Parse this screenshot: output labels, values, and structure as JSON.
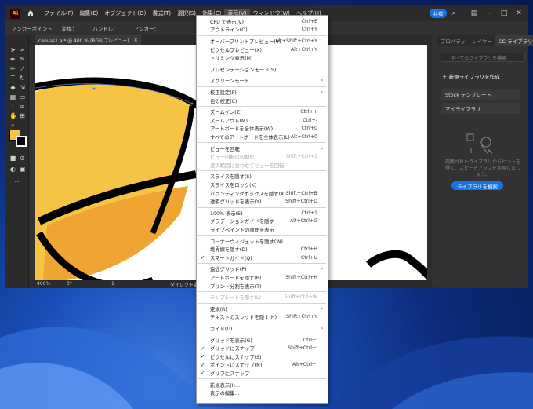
{
  "menubar": {
    "logo": "Ai",
    "items": [
      "ファイル(F)",
      "編集(E)",
      "オブジェクト(O)",
      "書式(T)",
      "選択(S)",
      "効果(C)",
      "表示(V)",
      "ウィンドウ(W)",
      "ヘルプ(H)"
    ],
    "share": "共有"
  },
  "ctrlbar": {
    "anchor_label": "アンカーポイント",
    "convert_label": "変換：",
    "handle_label": "ハンドル：",
    "anchor_label2": "アンカー："
  },
  "doc_tab": "canvas1.ai* @ 400 % (RGB/プレビュー)",
  "status": {
    "zoom": "400%",
    "rotation": "0°",
    "artboard": "1",
    "tool": "ダイレクト選択"
  },
  "panel": {
    "tabs": [
      "プロパティ",
      "レイヤー",
      "CC ライブラリ"
    ],
    "search_placeholder": "すべてのライブラリを検索",
    "new_library": "新規ライブラリを作成",
    "libraries": [
      "Stock テンプレート",
      "マイライブラリ"
    ],
    "description": "両面されたライブラリからヒントを得て、スピードアップを実現しましょう。",
    "button": "ライブラリを検索"
  },
  "menu": {
    "items": [
      {
        "label": "CPU で表示(V)",
        "shortcut": "Ctrl+E",
        "check": false,
        "submenu": false,
        "disabled": false
      },
      {
        "label": "アウトライン(O)",
        "shortcut": "Ctrl+Y",
        "check": false,
        "submenu": false,
        "disabled": false
      },
      {
        "sep": true
      },
      {
        "label": "オーバープリントプレビュー(V)",
        "shortcut": "Alt+Shift+Ctrl+Y",
        "check": false,
        "submenu": false,
        "disabled": false
      },
      {
        "label": "ピクセルプレビュー(X)",
        "shortcut": "Alt+Ctrl+Y",
        "check": false,
        "submenu": false,
        "disabled": false
      },
      {
        "label": "トリミング表示(M)",
        "shortcut": "",
        "check": false,
        "submenu": false,
        "disabled": false
      },
      {
        "sep": true
      },
      {
        "label": "プレゼンテーションモード(S)",
        "shortcut": "",
        "check": false,
        "submenu": false,
        "disabled": false
      },
      {
        "sep": true
      },
      {
        "label": "スクリーンモード",
        "shortcut": "",
        "check": false,
        "submenu": true,
        "disabled": false
      },
      {
        "sep": true
      },
      {
        "label": "校正設定(F)",
        "shortcut": "",
        "check": false,
        "submenu": true,
        "disabled": false
      },
      {
        "label": "色の校正(C)",
        "shortcut": "",
        "check": false,
        "submenu": false,
        "disabled": false
      },
      {
        "sep": true
      },
      {
        "label": "ズームイン(Z)",
        "shortcut": "Ctrl++",
        "check": false,
        "submenu": false,
        "disabled": false
      },
      {
        "label": "ズームアウト(M)",
        "shortcut": "Ctrl+-",
        "check": false,
        "submenu": false,
        "disabled": false
      },
      {
        "label": "アートボードを全体表示(W)",
        "shortcut": "Ctrl+0",
        "check": false,
        "submenu": false,
        "disabled": false
      },
      {
        "label": "すべてのアートボードを全体表示(L)",
        "shortcut": "Alt+Ctrl+0",
        "check": false,
        "submenu": false,
        "disabled": false
      },
      {
        "sep": true
      },
      {
        "label": "ビューを回転",
        "shortcut": "",
        "check": false,
        "submenu": true,
        "disabled": false
      },
      {
        "label": "ビュー回転の初期化",
        "shortcut": "Shift+Ctrl+1",
        "check": false,
        "submenu": false,
        "disabled": true
      },
      {
        "label": "選択範囲に合わせてビューを回転",
        "shortcut": "",
        "check": false,
        "submenu": false,
        "disabled": true
      },
      {
        "sep": true
      },
      {
        "label": "スライスを隠す(S)",
        "shortcut": "",
        "check": false,
        "submenu": false,
        "disabled": false
      },
      {
        "label": "スライスをロック(K)",
        "shortcut": "",
        "check": false,
        "submenu": false,
        "disabled": false
      },
      {
        "label": "バウンディングボックスを隠す(X)",
        "shortcut": "Shift+Ctrl+B",
        "check": false,
        "submenu": false,
        "disabled": false
      },
      {
        "label": "透明グリッドを表示(Y)",
        "shortcut": "Shift+Ctrl+D",
        "check": false,
        "submenu": false,
        "disabled": false
      },
      {
        "sep": true
      },
      {
        "label": "100% 表示(E)",
        "shortcut": "Ctrl+1",
        "check": false,
        "submenu": false,
        "disabled": false
      },
      {
        "label": "グラデーションガイドを隠す",
        "shortcut": "Alt+Ctrl+G",
        "check": false,
        "submenu": false,
        "disabled": false
      },
      {
        "label": "ライブペイントの隙間を表示",
        "shortcut": "",
        "check": false,
        "submenu": false,
        "disabled": false
      },
      {
        "sep": true
      },
      {
        "label": "コーナーウィジェットを隠す(W)",
        "shortcut": "",
        "check": false,
        "submenu": false,
        "disabled": false
      },
      {
        "label": "境界線を隠す(D)",
        "shortcut": "Ctrl+H",
        "check": false,
        "submenu": false,
        "disabled": false
      },
      {
        "label": "スマートガイド(Q)",
        "shortcut": "Ctrl+U",
        "check": true,
        "submenu": false,
        "disabled": false
      },
      {
        "sep": true
      },
      {
        "label": "遠近グリッド(P)",
        "shortcut": "",
        "check": false,
        "submenu": true,
        "disabled": false
      },
      {
        "label": "アートボードを隠す(B)",
        "shortcut": "Shift+Ctrl+H",
        "check": false,
        "submenu": false,
        "disabled": false
      },
      {
        "label": "プリント分割を表示(T)",
        "shortcut": "",
        "check": false,
        "submenu": false,
        "disabled": false
      },
      {
        "sep": true
      },
      {
        "label": "テンプレートを隠す(L)",
        "shortcut": "Shift+Ctrl+W",
        "check": false,
        "submenu": false,
        "disabled": true
      },
      {
        "sep": true
      },
      {
        "label": "定規(R)",
        "shortcut": "",
        "check": false,
        "submenu": true,
        "disabled": false
      },
      {
        "label": "テキストのスレッドを隠す(H)",
        "shortcut": "Shift+Ctrl+Y",
        "check": false,
        "submenu": false,
        "disabled": false
      },
      {
        "sep": true
      },
      {
        "label": "ガイド(U)",
        "shortcut": "",
        "check": false,
        "submenu": true,
        "disabled": false
      },
      {
        "sep": true
      },
      {
        "label": "グリッドを表示(G)",
        "shortcut": "Ctrl+'",
        "check": false,
        "submenu": false,
        "disabled": false
      },
      {
        "label": "グリッドにスナップ",
        "shortcut": "Shift+Ctrl+'",
        "check": true,
        "submenu": false,
        "disabled": false
      },
      {
        "label": "ピクセルにスナップ(S)",
        "shortcut": "",
        "check": true,
        "submenu": false,
        "disabled": false
      },
      {
        "label": "ポイントにスナップ(N)",
        "shortcut": "Alt+Ctrl+'",
        "check": true,
        "submenu": false,
        "disabled": false
      },
      {
        "label": "グリフにスナップ",
        "shortcut": "",
        "check": true,
        "submenu": false,
        "disabled": false
      },
      {
        "sep": true
      },
      {
        "label": "新規表示(I)...",
        "shortcut": "",
        "check": false,
        "submenu": false,
        "disabled": false
      },
      {
        "label": "表示の編集...",
        "shortcut": "",
        "check": false,
        "submenu": false,
        "disabled": false
      }
    ]
  }
}
